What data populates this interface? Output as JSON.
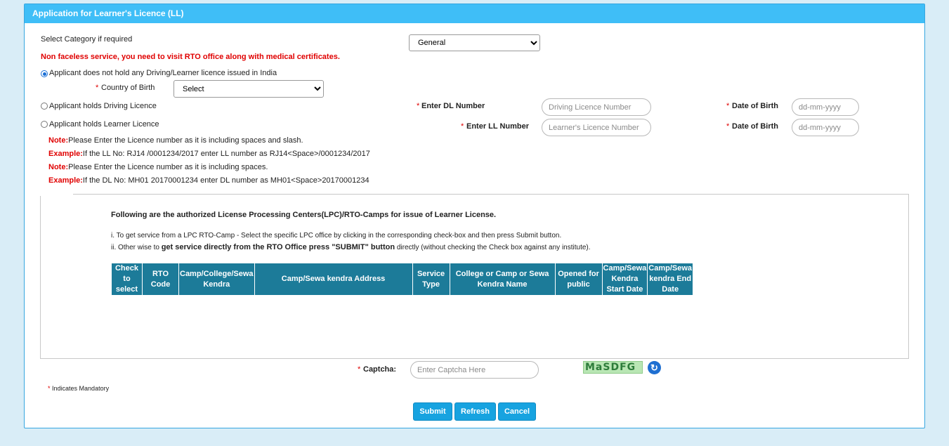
{
  "header": {
    "title": "Application for Learner's Licence (LL)"
  },
  "category": {
    "label": "Select Category if required",
    "selected": "General"
  },
  "warning": "Non faceless service, you need to visit RTO office along with medical certificates.",
  "option_no_licence": {
    "label": "Applicant does not hold any Driving/Learner licence issued in India",
    "country_label": "Country of Birth",
    "country_selected": "Select"
  },
  "option_dl": {
    "label": "Applicant holds Driving Licence",
    "number_label": "Enter DL Number",
    "number_placeholder": "Driving Licence Number",
    "dob_label": "Date of Birth",
    "dob_placeholder": "dd-mm-yyyy"
  },
  "option_ll": {
    "label": "Applicant holds Learner Licence",
    "number_label": "Enter LL Number",
    "number_placeholder": "Learner's Licence Number",
    "dob_label": "Date of Birth",
    "dob_placeholder": "dd-mm-yyyy"
  },
  "notes": [
    {
      "prefix": "Note:",
      "text": "Please Enter the Licence number as it is including spaces and slash."
    },
    {
      "prefix": "Example:",
      "text": "If the LL No: RJ14 /0001234/2017 enter LL number as RJ14<Space>/0001234/2017"
    },
    {
      "prefix": "Note:",
      "text": "Please Enter the Licence number as it is including spaces."
    },
    {
      "prefix": "Example:",
      "text": "If the DL No: MH01 20170001234 enter DL number as MH01<Space>20170001234"
    }
  ],
  "lpc": {
    "heading": "Following are the authorized License Processing Centers(LPC)/RTO-Camps for issue of Learner License.",
    "line1": "i. To get service from a LPC RTO-Camp - Select the specific LPC office by clicking in the corresponding check-box and then press Submit button.",
    "line2_pre": "ii. Other wise to ",
    "line2_bold": "get service directly from the RTO Office press \"SUBMIT\" button",
    "line2_post": " directly (without checking the Check box against any institute).",
    "columns": [
      "Check to select",
      "RTO Code",
      "Camp/College/Sewa Kendra",
      "Camp/Sewa kendra Address",
      "Service Type",
      "College or Camp or Sewa Kendra Name",
      "Opened for public",
      "Camp/Sewa Kendra Start Date",
      "Camp/Sewa kendra End Date"
    ]
  },
  "captcha": {
    "label": "Captcha:",
    "placeholder": "Enter Captcha Here",
    "code": "MaSDFG"
  },
  "mandatory_note": "Indicates Mandatory",
  "asterisk": "*",
  "buttons": {
    "submit": "Submit",
    "refresh": "Refresh",
    "cancel": "Cancel"
  },
  "icons": {
    "captcha_refresh": "refresh-icon"
  }
}
